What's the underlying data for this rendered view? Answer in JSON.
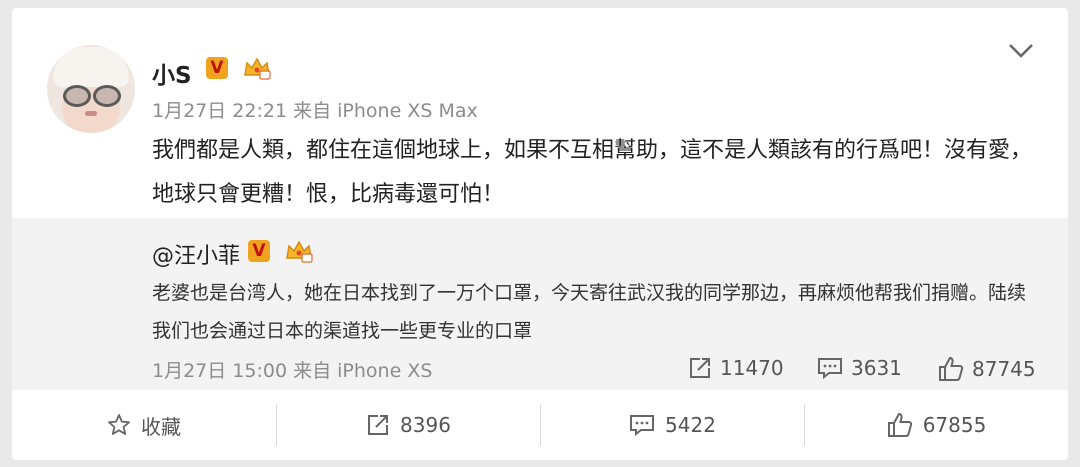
{
  "post": {
    "username": "小S",
    "verified_badge": "V",
    "timestamp": "1月27日 22:21",
    "source": "来自 iPhone XS Max",
    "text": "我們都是人類，都住在這個地球上，如果不互相幫助，這不是人類該有的行爲吧！沒有愛，地球只會更糟！恨，比病毒還可怕！"
  },
  "repost": {
    "username": "@汪小菲",
    "verified_badge": "V",
    "text": "老婆也是台湾人，她在日本找到了一万个口罩，今天寄往武汉我的同学那边，再麻烦他帮我们捐赠。陆续我们也会通过日本的渠道找一些更专业的口罩",
    "timestamp": "1月27日 15:00",
    "source": "来自 iPhone XS",
    "stats": {
      "reposts": "11470",
      "comments": "3631",
      "likes": "87745"
    }
  },
  "actions": {
    "favorite_label": "收藏",
    "repost_count": "8396",
    "comment_count": "5422",
    "like_count": "67855"
  },
  "colors": {
    "verified_badge": "#f0a31d",
    "verified_v": "#c0120f",
    "card_bg": "#ffffff",
    "repost_bg": "#f3f3f3",
    "page_bg": "#e9e9ea"
  },
  "icons": [
    "chevron-down-icon",
    "crown-icon",
    "repost-icon",
    "comment-icon",
    "like-icon",
    "star-icon"
  ]
}
